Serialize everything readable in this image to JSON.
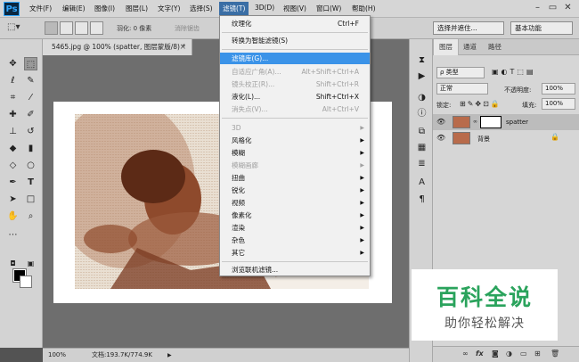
{
  "app": {
    "logo": "Ps"
  },
  "menubar": [
    "文件(F)",
    "编辑(E)",
    "图像(I)",
    "图层(L)",
    "文字(Y)",
    "选择(S)",
    "滤镜(T)",
    "3D(D)",
    "视图(V)",
    "窗口(W)",
    "帮助(H)"
  ],
  "window_controls": {
    "minimize": "–",
    "restore": "▭",
    "close": "✕"
  },
  "options": {
    "feather_label": "羽化: 0 像素",
    "antialias_label": "消除锯齿",
    "select_mask_button": "选择并遮住...",
    "workspace_select": "基本功能"
  },
  "document": {
    "tab_title": "5465.jpg @ 100% (spatter, 图层蒙版/8) *",
    "tab_close": "×",
    "zoom": "100%",
    "doc_info": "文档:193.7K/774.9K"
  },
  "filter_menu": [
    {
      "label": "纹理化",
      "shortcut": "Ctrl+F",
      "disabled": false
    },
    {
      "label": "转换为智能滤镜(S)",
      "shortcut": "",
      "disabled": false
    },
    {
      "label": "滤镜库(G)...",
      "shortcut": "",
      "disabled": false,
      "highlighted": true
    },
    {
      "label": "自适应广角(A)...",
      "shortcut": "Alt+Shift+Ctrl+A",
      "disabled": true
    },
    {
      "label": "镜头校正(R)...",
      "shortcut": "Shift+Ctrl+R",
      "disabled": true
    },
    {
      "label": "液化(L)...",
      "shortcut": "Shift+Ctrl+X",
      "disabled": false
    },
    {
      "label": "消失点(V)...",
      "shortcut": "Alt+Ctrl+V",
      "disabled": true
    },
    {
      "label": "3D",
      "shortcut": "",
      "disabled": true,
      "submenu": true
    },
    {
      "label": "风格化",
      "shortcut": "",
      "disabled": false,
      "submenu": true
    },
    {
      "label": "模糊",
      "shortcut": "",
      "disabled": false,
      "submenu": true
    },
    {
      "label": "模糊画廊",
      "shortcut": "",
      "disabled": true,
      "submenu": true
    },
    {
      "label": "扭曲",
      "shortcut": "",
      "disabled": false,
      "submenu": true
    },
    {
      "label": "锐化",
      "shortcut": "",
      "disabled": false,
      "submenu": true
    },
    {
      "label": "视频",
      "shortcut": "",
      "disabled": false,
      "submenu": true
    },
    {
      "label": "像素化",
      "shortcut": "",
      "disabled": false,
      "submenu": true
    },
    {
      "label": "渲染",
      "shortcut": "",
      "disabled": false,
      "submenu": true
    },
    {
      "label": "杂色",
      "shortcut": "",
      "disabled": false,
      "submenu": true
    },
    {
      "label": "其它",
      "shortcut": "",
      "disabled": false,
      "submenu": true
    },
    {
      "label": "浏览联机滤镜...",
      "shortcut": "",
      "disabled": false
    }
  ],
  "layers_panel": {
    "tabs": [
      "图层",
      "通道",
      "路径"
    ],
    "kind_filter": "ρ 类型",
    "blend_mode": "正常",
    "opacity_label": "不透明度:",
    "opacity_value": "100%",
    "lock_label": "锁定:",
    "fill_label": "填充:",
    "fill_value": "100%",
    "layers": [
      {
        "name": "spatter",
        "selected": true,
        "has_mask": true,
        "locked": false
      },
      {
        "name": "背景",
        "selected": false,
        "has_mask": false,
        "locked": true
      }
    ]
  },
  "watermark": {
    "title": "百科全说",
    "subtitle": "助你轻松解决"
  },
  "colors": {
    "highlight": "#3b93e8",
    "sepia": "#9b5a3c",
    "watermark_green": "#2aa35c"
  }
}
